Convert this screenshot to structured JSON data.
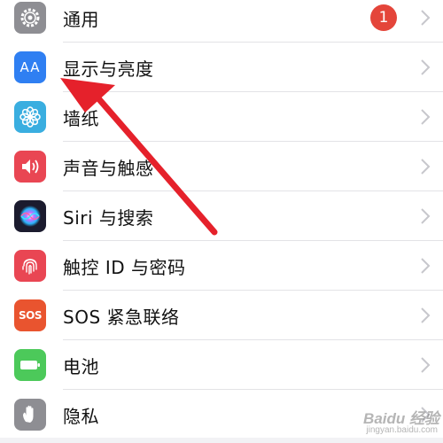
{
  "settings_list": {
    "items": [
      {
        "label": "通用",
        "icon": "gear-icon",
        "icon_bg": "#8e8e93",
        "badge": "1"
      },
      {
        "label": "显示与亮度",
        "icon": "text-size-icon",
        "icon_bg": "#2f7ff2",
        "icon_text": "AA"
      },
      {
        "label": "墙纸",
        "icon": "flower-icon",
        "icon_bg": "#3aaee0"
      },
      {
        "label": "声音与触感",
        "icon": "speaker-icon",
        "icon_bg": "#e94653"
      },
      {
        "label": "Siri 与搜索",
        "icon": "siri-icon",
        "icon_bg": "#1b1b2e"
      },
      {
        "label": "触控 ID 与密码",
        "icon": "fingerprint-icon",
        "icon_bg": "#e94653"
      },
      {
        "label": "SOS 紧急联络",
        "icon": "sos-icon",
        "icon_bg": "#e9542f",
        "icon_text": "SOS"
      },
      {
        "label": "电池",
        "icon": "battery-icon",
        "icon_bg": "#4cc95a"
      },
      {
        "label": "隐私",
        "icon": "hand-icon",
        "icon_bg": "#8e8e93"
      }
    ]
  },
  "annotation": {
    "arrow_color": "#e5212b"
  },
  "watermark": {
    "text": "Baidu 经验",
    "subtext": "jingyan.baidu.com"
  }
}
